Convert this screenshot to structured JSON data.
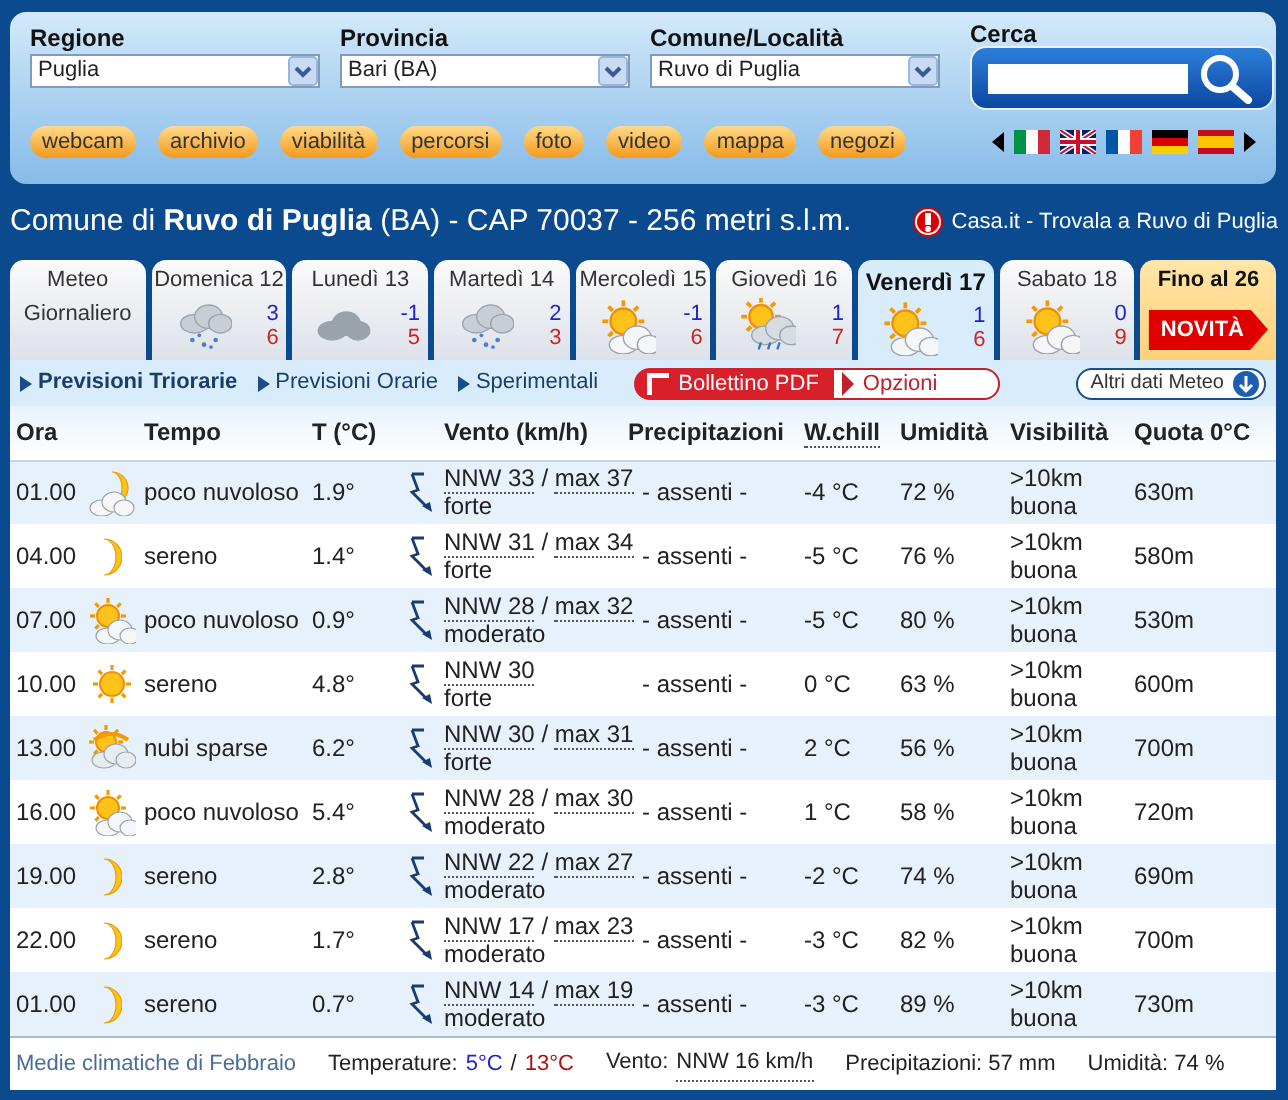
{
  "filters": [
    {
      "label": "Regione",
      "value": "Puglia"
    },
    {
      "label": "Provincia",
      "value": "Bari (BA)"
    },
    {
      "label": "Comune/Località",
      "value": "Ruvo di Puglia"
    }
  ],
  "search": {
    "label": "Cerca"
  },
  "quick_links": [
    "webcam",
    "archivio",
    "viabilità",
    "percorsi",
    "foto",
    "video",
    "mappa",
    "negozi"
  ],
  "languages": [
    {
      "kind": "it"
    },
    {
      "kind": "gb"
    },
    {
      "kind": "fr"
    },
    {
      "kind": "de"
    },
    {
      "kind": "es"
    }
  ],
  "location": {
    "title": "Comune di **Ruvo di Puglia** (BA) - CAP 70037 - 256 metri s.l.m.",
    "ad": "Casa.it - Trovala a Ruvo di Puglia"
  },
  "day_tabs": [
    {
      "kind": "daily",
      "label": "Meteo Giornaliero",
      "selected": false
    },
    {
      "kind": "snow",
      "label": "Domenica 12",
      "min": "3",
      "max": "6",
      "selected": false
    },
    {
      "kind": "cloud",
      "label": "Lunedì 13",
      "min": "-1",
      "max": "5",
      "selected": false
    },
    {
      "kind": "snow",
      "label": "Martedì 14",
      "min": "2",
      "max": "3",
      "selected": false
    },
    {
      "kind": "suncloud",
      "label": "Mercoledì 15",
      "min": "-1",
      "max": "6",
      "selected": false
    },
    {
      "kind": "sunrain",
      "label": "Giovedì 16",
      "min": "1",
      "max": "7",
      "selected": false
    },
    {
      "kind": "suncloud",
      "label": "Venerdì 17",
      "min": "1",
      "max": "6",
      "selected": true
    },
    {
      "kind": "suncloud",
      "label": "Sabato 18",
      "min": "0",
      "max": "9",
      "selected": false
    },
    {
      "kind": "promo",
      "label": "Fino al 26",
      "badge": "NOVITÀ",
      "selected": false
    }
  ],
  "views": [
    {
      "label": "Previsioni Triorarie",
      "selected": true
    },
    {
      "label": "Previsioni Orarie",
      "selected": false
    },
    {
      "label": "Sperimentali",
      "selected": false
    }
  ],
  "actions": {
    "pdf": "Bollettino PDF",
    "options": "Opzioni",
    "more": "Altri dati Meteo"
  },
  "table": {
    "columns": [
      "Ora",
      "Tempo",
      "T (°C)",
      "Vento (km/h)",
      "Precipitazioni",
      "W.chill",
      "Umidità",
      "Visibilità",
      "Quota 0°C"
    ],
    "rows": [
      {
        "time": "01.00",
        "kind": "mooncloud",
        "sky": "poco nuvoloso",
        "temp": "1.9°",
        "wind": "NNW 33",
        "separator": "/",
        "gust": "max 37",
        "strength": "forte",
        "precip": "- assenti -",
        "windchill": "-4 °C",
        "humidity": "72 %",
        "visibility": ">10km",
        "visibility_note": "buona",
        "freezing": "630m"
      },
      {
        "time": "04.00",
        "kind": "moon",
        "sky": "sereno",
        "temp": "1.4°",
        "wind": "NNW 31",
        "separator": "/",
        "gust": "max 34",
        "strength": "forte",
        "precip": "- assenti -",
        "windchill": "-5 °C",
        "humidity": "76 %",
        "visibility": ">10km",
        "visibility_note": "buona",
        "freezing": "580m"
      },
      {
        "time": "07.00",
        "kind": "suncloud",
        "sky": "poco nuvoloso",
        "temp": "0.9°",
        "wind": "NNW 28",
        "separator": "/",
        "gust": "max 32",
        "strength": "moderato",
        "precip": "- assenti -",
        "windchill": "-5 °C",
        "humidity": "80 %",
        "visibility": ">10km",
        "visibility_note": "buona",
        "freezing": "530m"
      },
      {
        "time": "10.00",
        "kind": "sun",
        "sky": "sereno",
        "temp": "4.8°",
        "wind": "NNW 30",
        "strength": "forte",
        "precip": "- assenti -",
        "windchill": "0 °C",
        "humidity": "63 %",
        "visibility": ">10km",
        "visibility_note": "buona",
        "freezing": "600m"
      },
      {
        "time": "13.00",
        "kind": "scattered",
        "sky": "nubi sparse",
        "temp": "6.2°",
        "wind": "NNW 30",
        "separator": "/",
        "gust": "max 31",
        "strength": "forte",
        "precip": "- assenti -",
        "windchill": "2 °C",
        "humidity": "56 %",
        "visibility": ">10km",
        "visibility_note": "buona",
        "freezing": "700m"
      },
      {
        "time": "16.00",
        "kind": "suncloud",
        "sky": "poco nuvoloso",
        "temp": "5.4°",
        "wind": "NNW 28",
        "separator": "/",
        "gust": "max 30",
        "strength": "moderato",
        "precip": "- assenti -",
        "windchill": "1 °C",
        "humidity": "58 %",
        "visibility": ">10km",
        "visibility_note": "buona",
        "freezing": "720m"
      },
      {
        "time": "19.00",
        "kind": "moon",
        "sky": "sereno",
        "temp": "2.8°",
        "wind": "NNW 22",
        "separator": "/",
        "gust": "max 27",
        "strength": "moderato",
        "precip": "- assenti -",
        "windchill": "-2 °C",
        "humidity": "74 %",
        "visibility": ">10km",
        "visibility_note": "buona",
        "freezing": "690m"
      },
      {
        "time": "22.00",
        "kind": "moon",
        "sky": "sereno",
        "temp": "1.7°",
        "wind": "NNW 17",
        "separator": "/",
        "gust": "max 23",
        "strength": "moderato",
        "precip": "- assenti -",
        "windchill": "-3 °C",
        "humidity": "82 %",
        "visibility": ">10km",
        "visibility_note": "buona",
        "freezing": "700m"
      },
      {
        "time": "01.00",
        "kind": "moon",
        "sky": "sereno",
        "temp": "0.7°",
        "wind": "NNW 14",
        "separator": "/",
        "gust": "max 19",
        "strength": "moderato",
        "precip": "- assenti -",
        "windchill": "-3 °C",
        "humidity": "89 %",
        "visibility": ">10km",
        "visibility_note": "buona",
        "freezing": "730m"
      }
    ]
  },
  "footer": {
    "link": "Medie climatiche di Febbraio",
    "temperature_label": "Temperature:",
    "temp_min": "5°C",
    "separator": "/",
    "temp_max": "13°C",
    "wind_label": "Vento:",
    "wind": "NNW 16 km/h",
    "precipitation": "Precipitazioni: 57 mm",
    "humidity": "Umidità: 74 %"
  }
}
